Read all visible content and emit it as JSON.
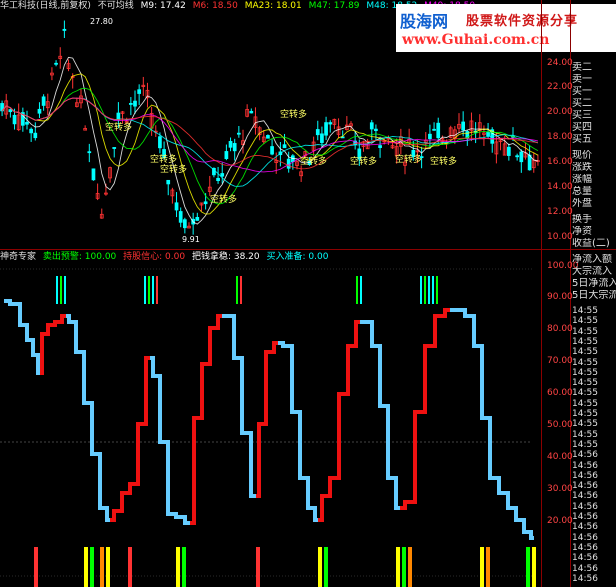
{
  "header": {
    "title": "华工科技(日线,前复权)",
    "indicator": "不可均线",
    "ma_items": [
      {
        "label": "M9: 17.42",
        "color": "#ffffff"
      },
      {
        "label": "M6: 18.50",
        "color": "#ff3333"
      },
      {
        "label": "MA23: 18.01",
        "color": "#ffff00"
      },
      {
        "label": "M47: 17.89",
        "color": "#00ff00"
      },
      {
        "label": "M48: 18.52",
        "color": "#00ffff"
      },
      {
        "label": "M49: 18.50",
        "color": "#ff00ff"
      }
    ]
  },
  "watermark": {
    "logo": "股海网",
    "tagline": "股票软件资源分享",
    "url": "www.Guhai.com.cn"
  },
  "upper": {
    "high_label": "27.80",
    "low_label": "9.91",
    "annotation": "空转多",
    "annotation_count": 9,
    "markers": [
      "涨",
      "停",
      "涨",
      "财"
    ],
    "axis": [
      "24.00",
      "22.00",
      "20.00",
      "18.00",
      "16.00",
      "14.00",
      "12.00",
      "10.00"
    ]
  },
  "lower_header": {
    "name": "神奇专家",
    "items": [
      {
        "label": "卖出预警: 100.00",
        "color": "#00ff00"
      },
      {
        "label": "持股信心: 0.00",
        "color": "#ff3333"
      },
      {
        "label": "把钱拿稳: 38.20",
        "color": "#ffffff"
      },
      {
        "label": "买入准备: 0.00",
        "color": "#00ffff"
      }
    ],
    "axis": [
      "100.00",
      "90.00",
      "80.00",
      "70.00",
      "60.00",
      "50.00",
      "40.00",
      "30.00",
      "20.00"
    ]
  },
  "side_panel": {
    "quote_labels": [
      "卖二",
      "卖一",
      "买一",
      "买二",
      "买三",
      "买四",
      "买五"
    ],
    "stats_labels": [
      "现价",
      "涨跌",
      "涨幅",
      "总量",
      "外盘",
      "换手",
      "净资",
      "收益(二)"
    ],
    "flow_labels": [
      "净流入额",
      "大宗流入",
      "5日净流入",
      "5日大宗流"
    ],
    "times": [
      "14:55",
      "14:55",
      "14:55",
      "14:55",
      "14:55",
      "14:55",
      "14:55",
      "14:55",
      "14:55",
      "14:55",
      "14:55",
      "14:55",
      "14:55",
      "14:55",
      "14:56",
      "14:56",
      "14:56",
      "14:56",
      "14:56",
      "14:56",
      "14:56",
      "14:56",
      "14:56",
      "14:56",
      "14:56",
      "14:56",
      "14:56"
    ]
  },
  "colors": {
    "up": "#ff3333",
    "down": "#00ffff",
    "line_up": "#ee1111",
    "line_down": "#66ccff",
    "axis_grid": "#8b0000"
  }
}
